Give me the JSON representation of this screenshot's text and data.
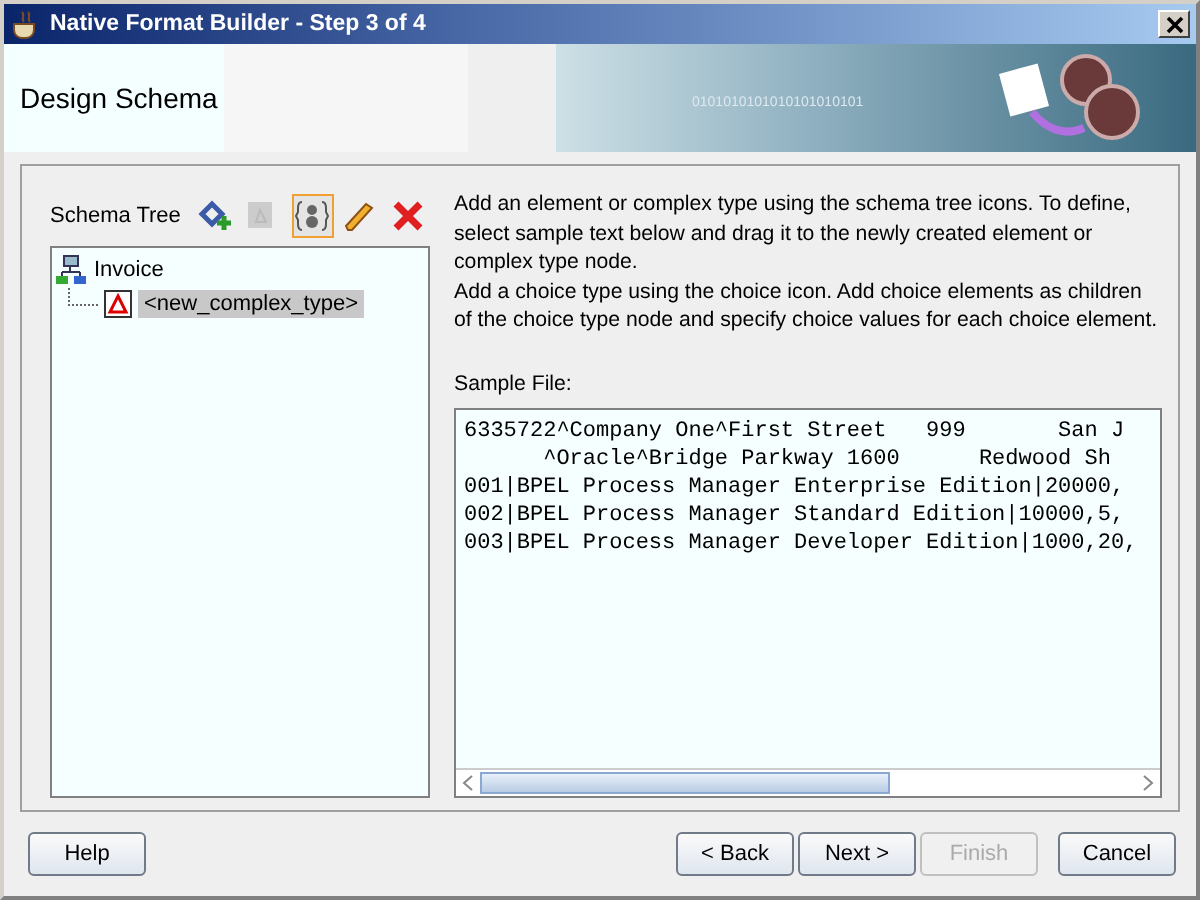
{
  "window": {
    "title": "Native Format Builder - Step 3 of 4"
  },
  "header": {
    "title": "Design Schema",
    "banner_text": "0101010101010101010101"
  },
  "schema_tree": {
    "label": "Schema Tree",
    "toolbar": [
      {
        "kind": "add",
        "selected": false,
        "disabled": false
      },
      {
        "kind": "element",
        "selected": false,
        "disabled": true
      },
      {
        "kind": "choice",
        "selected": true,
        "disabled": false
      },
      {
        "kind": "edit",
        "selected": false,
        "disabled": false
      },
      {
        "kind": "delete",
        "selected": false,
        "disabled": false
      }
    ],
    "nodes": [
      {
        "label": "Invoice",
        "kind": "root",
        "selected": false,
        "children": [
          {
            "label": "<new_complex_type>",
            "kind": "complex",
            "selected": true
          }
        ]
      }
    ]
  },
  "instructions": [
    "Add an element or complex type using the schema tree icons. To define, select sample text below and drag it to the newly created element or complex type node.",
    "Add a choice type using the choice icon. Add choice elements as children of the choice type node and specify choice values for each choice element."
  ],
  "sample_file": {
    "label": "Sample File:",
    "lines": [
      "6335722^Company One^First Street   999       San J",
      "      ^Oracle^Bridge Parkway 1600      Redwood Sh",
      "001|BPEL Process Manager Enterprise Edition|20000,",
      "002|BPEL Process Manager Standard Edition|10000,5,",
      "003|BPEL Process Manager Developer Edition|1000,20,"
    ]
  },
  "buttons": [
    {
      "label": "Help",
      "disabled": false,
      "kind": "help"
    },
    {
      "label": "< Back",
      "disabled": false,
      "kind": "nav"
    },
    {
      "label": "Next >",
      "disabled": false,
      "kind": "nav"
    },
    {
      "label": "Finish",
      "disabled": true,
      "kind": "nav"
    },
    {
      "label": "Cancel",
      "disabled": false,
      "kind": "cancel"
    }
  ]
}
